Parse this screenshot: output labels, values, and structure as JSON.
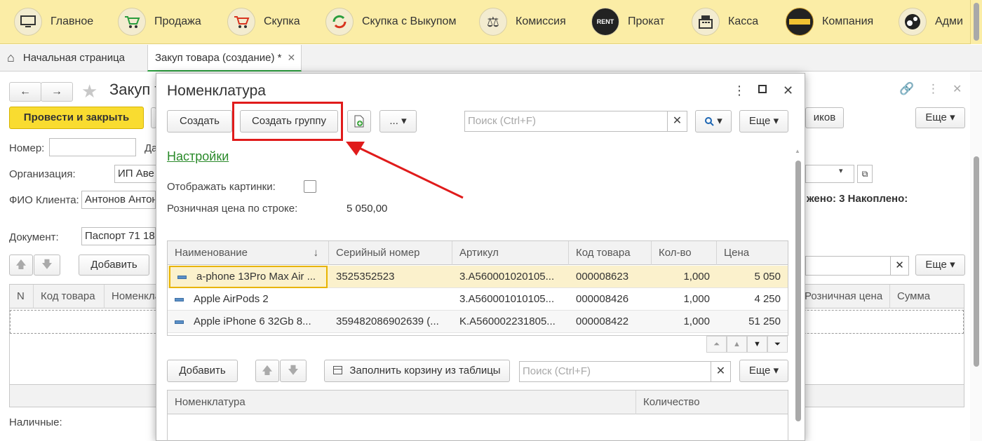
{
  "sections": [
    {
      "label": "Главное",
      "icon": "monitor-icon"
    },
    {
      "label": "Продажа",
      "icon": "cart-up-icon"
    },
    {
      "label": "Скупка",
      "icon": "cart-down-icon"
    },
    {
      "label": "Скупка с Выкупом",
      "icon": "cycle-icon"
    },
    {
      "label": "Комиссия",
      "icon": "scales-icon"
    },
    {
      "label": "Прокат",
      "icon": "rent-icon"
    },
    {
      "label": "Касса",
      "icon": "cash-register-icon"
    },
    {
      "label": "Компания",
      "icon": "company-logo-icon"
    },
    {
      "label": "Адми",
      "icon": "gears-icon"
    }
  ],
  "tabs": {
    "home": "Начальная страница",
    "active": "Закуп товара (создание) *"
  },
  "doc": {
    "title": "Закуп т",
    "post_close": "Провести и закрыть",
    "more": "Еще",
    "more2": "Еще",
    "add": "Добавить",
    "tovarov": "иков",
    "number_label": "Номер:",
    "date_label_part": "Да",
    "org_label": "Организация:",
    "org_value": "ИП Аве",
    "client_label": "ФИО Клиента:",
    "client_value": "Антонов Антон",
    "doc_label": "Документ:",
    "doc_value": "Паспорт 71 18",
    "stats": "жено: 3  Накоплено:",
    "cash_label": "Наличные:",
    "columns": [
      "N",
      "Код товара",
      "Номенкла",
      "Розничная цена",
      "Сумма"
    ]
  },
  "modal": {
    "title": "Номенклатура",
    "create": "Создать",
    "create_group": "Создать группу",
    "dots": "...",
    "search_placeholder": "Поиск (Ctrl+F)",
    "more": "Еще",
    "settings": "Настройки",
    "show_pictures": "Отображать картинки:",
    "retail_price_label": "Розничная цена по строке:",
    "retail_price_value": "5 050,00",
    "columns": [
      "Наименование",
      "Серийный номер",
      "Артикул",
      "Код товара",
      "Кол-во",
      "Цена"
    ],
    "rows": [
      {
        "name": "a-phone 13Pro Max Air ...",
        "serial": "3525352523",
        "article": "3.A560001020105...",
        "code": "000008623",
        "qty": "1,000",
        "price": "5 050"
      },
      {
        "name": "Apple AirPods 2",
        "serial": "",
        "article": "3.A560001010105...",
        "code": "000008426",
        "qty": "1,000",
        "price": "4 250"
      },
      {
        "name": "Apple iPhone 6 32Gb 8...",
        "serial": "359482086902639 (...",
        "article": "K.A560002231805...",
        "code": "000008422",
        "qty": "1,000",
        "price": "51 250"
      }
    ],
    "add": "Добавить",
    "fill_cart": "Заполнить корзину из таблицы",
    "search2_placeholder": "Поиск (Ctrl+F)",
    "more2": "Еще",
    "cart_columns": [
      "Номенклатура",
      "Количество"
    ]
  },
  "colors": {
    "topbar": "#fbeda6",
    "accent_yellow": "#f9dc30",
    "highlight_red": "#e01b1b",
    "link_green": "#2a8a2a",
    "tab_underline": "#2a9d3d"
  }
}
